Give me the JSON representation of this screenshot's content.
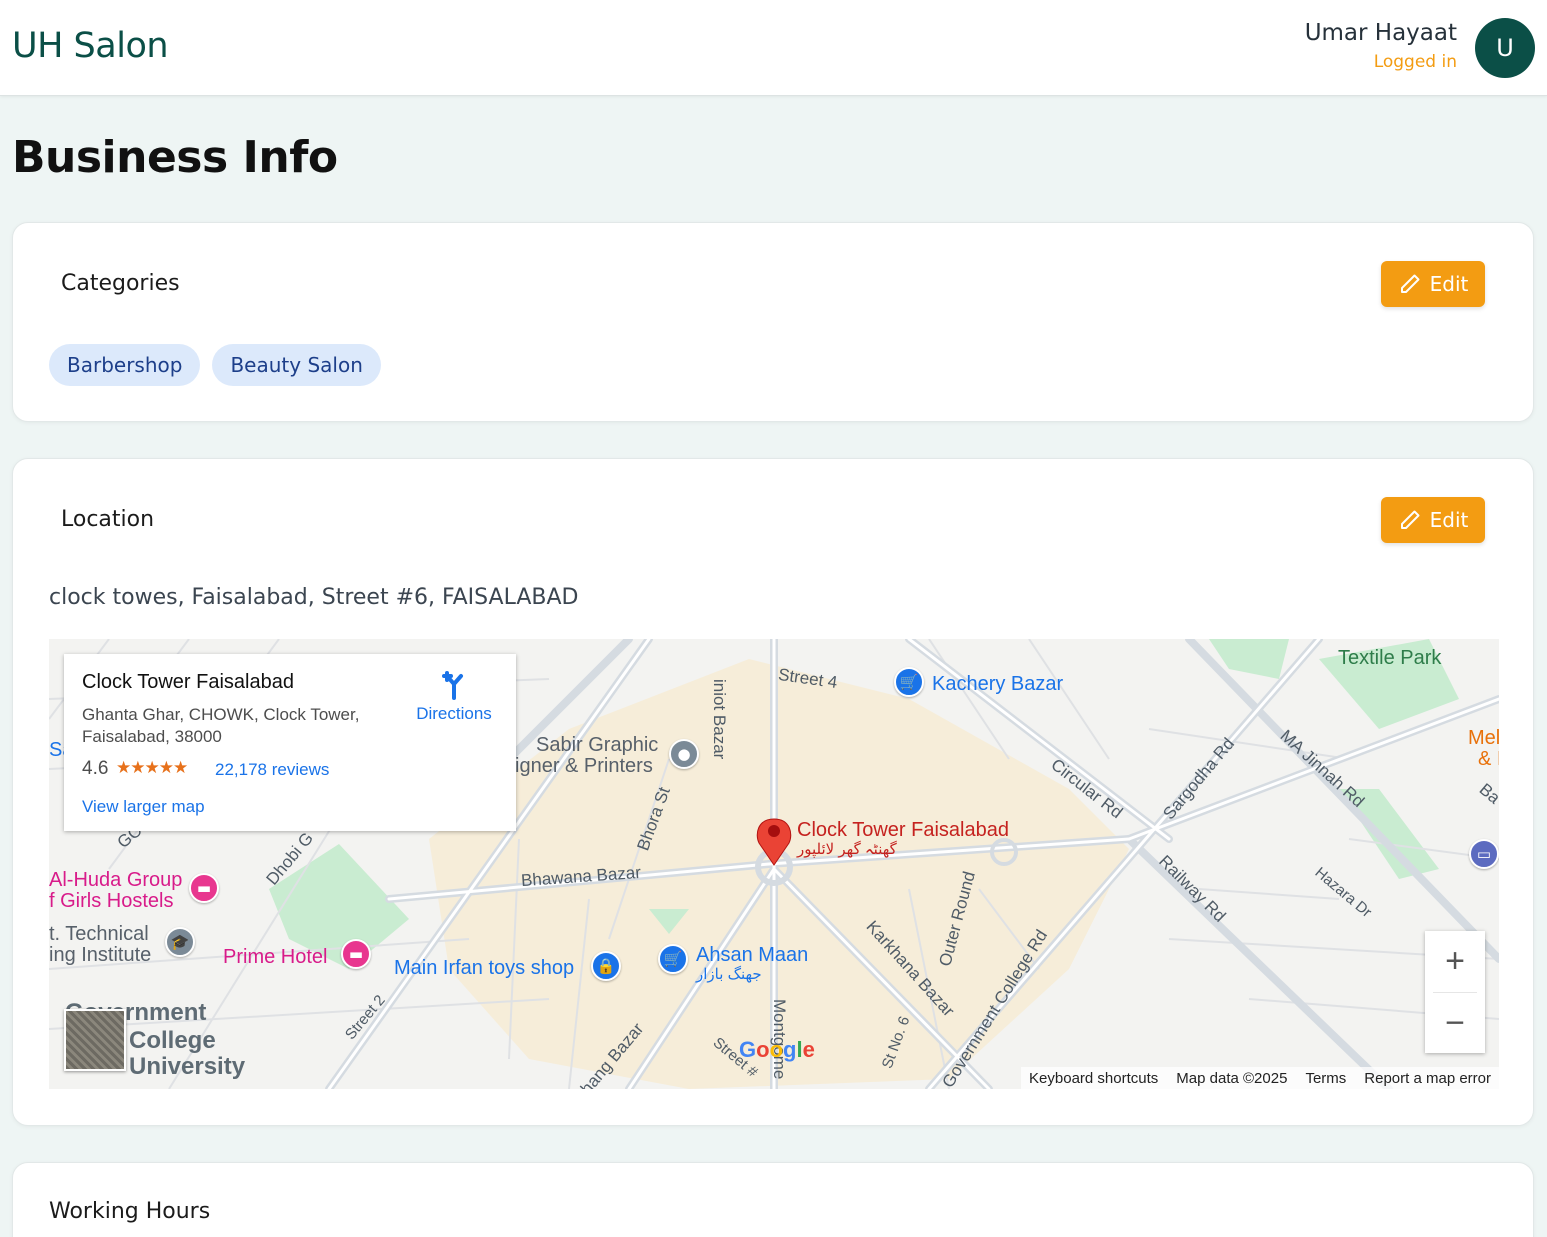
{
  "header": {
    "brand": "UH Salon",
    "user_name": "Umar Hayaat",
    "user_status": "Logged in",
    "avatar_letter": "U"
  },
  "page": {
    "title": "Business Info"
  },
  "categories": {
    "title": "Categories",
    "edit_label": "Edit",
    "items": [
      "Barbershop",
      "Beauty Salon"
    ]
  },
  "location": {
    "title": "Location",
    "edit_label": "Edit",
    "address": "clock towes, Faisalabad, Street #6, FAISALABAD",
    "map": {
      "place_name": "Clock Tower Faisalabad",
      "place_address": "Ghanta Ghar, CHOWK, Clock Tower, Faisalabad, 38000",
      "rating": "4.6",
      "stars": "★★★★★",
      "reviews": "22,178 reviews",
      "directions_label": "Directions",
      "larger_map_label": "View larger map",
      "marker_label": "Clock Tower Faisalabad",
      "marker_label_urdu": "گھنٹہ گھر لائلپور",
      "labels": {
        "kachery_bazar": "Kachery Bazar",
        "textile_park": "Textile Park",
        "sabir_graphic_1": "Sabir Graphic",
        "sabir_graphic_2": "igner & Printers",
        "street_4": "Street 4",
        "chiniot_bazar": "iniot Bazar",
        "bhora_st": "Bhora St",
        "bhawana_bazar": "Bhawana Bazar",
        "circular_rd": "Circular Rd",
        "sargodha_rd": "Sargodha Rd",
        "ma_jinnah_rd": "MA Jinnah Rd",
        "railway_rd": "Railway Rd",
        "hazara_dr": "Hazara Dr",
        "al_huda_1": "Al-Huda Group",
        "al_huda_2": "f Girls Hostels",
        "technical_1": "t. Technical",
        "technical_2": "ing Institute",
        "prime_hotel": "Prime Hotel",
        "main_irfan": "Main Irfan toys shop",
        "ahsan_maan": "Ahsan Maan",
        "ahsan_maan_urdu": "جھنگ بازار",
        "karkhana_bazar": "Karkhana Bazar",
        "outer_round": "Outer Round",
        "govt_college_rd": "Government College Rd",
        "st_no_6": "St No. 6",
        "street_2": "Street 2",
        "jhang_bazar": "hang Bazar",
        "montgomery": "Montgome",
        "govt_college_1": "Government",
        "govt_college_2": "College",
        "govt_college_3": "University",
        "mel_1": "Mel",
        "mel_2": "& I",
        "ba": "Ba",
        "gc": "GC",
        "dhobi": "Dhobi G",
        "sa": "Sa",
        "street_hash": "Street #"
      },
      "zoom_in": "+",
      "zoom_out": "−",
      "google": "Google",
      "footer": {
        "shortcuts": "Keyboard shortcuts",
        "map_data": "Map data ©2025",
        "terms": "Terms",
        "report": "Report a map error"
      }
    }
  },
  "working_hours": {
    "title": "Working Hours"
  },
  "colors": {
    "brand": "#0b4f47",
    "accent": "#f39c12",
    "chip_bg": "#dce9fb",
    "link_blue": "#1a73e8"
  }
}
